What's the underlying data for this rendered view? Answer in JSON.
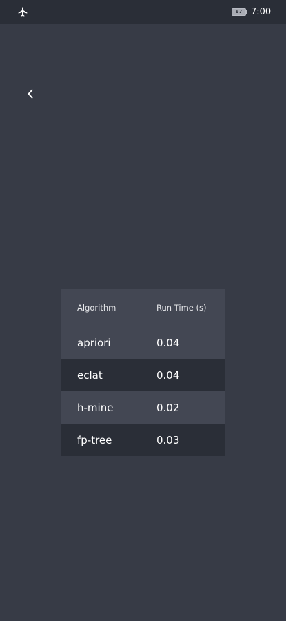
{
  "status_bar": {
    "airplane_icon": "airplane-icon",
    "battery_level": "67",
    "time": "7:00"
  },
  "nav": {
    "back_icon": "chevron-left-icon"
  },
  "table": {
    "headers": {
      "algorithm": "Algorithm",
      "run_time": "Run Time (s)"
    },
    "rows": [
      {
        "algorithm": "apriori",
        "run_time": "0.04"
      },
      {
        "algorithm": "eclat",
        "run_time": "0.04"
      },
      {
        "algorithm": "h-mine",
        "run_time": "0.02"
      },
      {
        "algorithm": "fp-tree",
        "run_time": "0.03"
      }
    ]
  },
  "colors": {
    "background": "#373b46",
    "status_bar": "#2a2e37",
    "row_light": "#434753",
    "row_dark": "#2a2e37",
    "text": "#ffffff"
  }
}
